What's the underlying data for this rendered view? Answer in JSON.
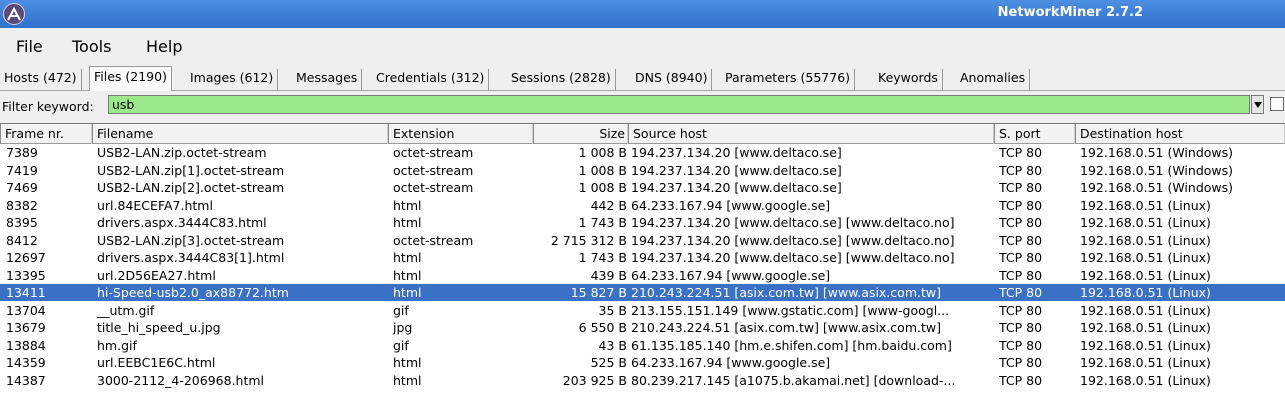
{
  "window": {
    "title": "NetworkMiner 2.7.2",
    "icon": "networkminer-app-icon"
  },
  "menu": [
    "File",
    "Tools",
    "Help"
  ],
  "tabs": [
    {
      "label": "Hosts (472)",
      "active": false
    },
    {
      "label": "Files (2190)",
      "active": true
    },
    {
      "label": "Images (612)",
      "active": false
    },
    {
      "label": "Messages",
      "active": false
    },
    {
      "label": "Credentials (312)",
      "active": false
    },
    {
      "label": "Sessions (2828)",
      "active": false
    },
    {
      "label": "DNS (8940)",
      "active": false
    },
    {
      "label": "Parameters (55776)",
      "active": false
    },
    {
      "label": "Keywords",
      "active": false
    },
    {
      "label": "Anomalies",
      "active": false
    }
  ],
  "filter": {
    "label": "Filter keyword:",
    "value": "usb",
    "dropdown_icon": "dropdown-arrow-icon",
    "input_color": "#9be98b"
  },
  "table": {
    "columns": [
      "Frame nr.",
      "Filename",
      "Extension",
      "Size",
      "Source host",
      "S. port",
      "Destination host"
    ],
    "selected_row_color": "#3a70c6",
    "rows": [
      {
        "frame": "7389",
        "filename": "USB2-LAN.zip.octet-stream",
        "extension": "octet-stream",
        "size": "1 008 B",
        "source": "194.237.134.20 [www.deltaco.se]",
        "sport": "TCP 80",
        "dest": "192.168.0.51 (Windows)",
        "selected": false
      },
      {
        "frame": "7419",
        "filename": "USB2-LAN.zip[1].octet-stream",
        "extension": "octet-stream",
        "size": "1 008 B",
        "source": "194.237.134.20 [www.deltaco.se]",
        "sport": "TCP 80",
        "dest": "192.168.0.51 (Windows)",
        "selected": false
      },
      {
        "frame": "7469",
        "filename": "USB2-LAN.zip[2].octet-stream",
        "extension": "octet-stream",
        "size": "1 008 B",
        "source": "194.237.134.20 [www.deltaco.se]",
        "sport": "TCP 80",
        "dest": "192.168.0.51 (Windows)",
        "selected": false
      },
      {
        "frame": "8382",
        "filename": "url.84ECEFA7.html",
        "extension": "html",
        "size": "442 B",
        "source": "64.233.167.94 [www.google.se]",
        "sport": "TCP 80",
        "dest": "192.168.0.51 (Linux)",
        "selected": false
      },
      {
        "frame": "8395",
        "filename": "drivers.aspx.3444C83.html",
        "extension": "html",
        "size": "1 743 B",
        "source": "194.237.134.20 [www.deltaco.se] [www.deltaco.no]",
        "sport": "TCP 80",
        "dest": "192.168.0.51 (Linux)",
        "selected": false
      },
      {
        "frame": "8412",
        "filename": "USB2-LAN.zip[3].octet-stream",
        "extension": "octet-stream",
        "size": "2 715 312 B",
        "source": "194.237.134.20 [www.deltaco.se] [www.deltaco.no]",
        "sport": "TCP 80",
        "dest": "192.168.0.51 (Linux)",
        "selected": false
      },
      {
        "frame": "12697",
        "filename": "drivers.aspx.3444C83[1].html",
        "extension": "html",
        "size": "1 743 B",
        "source": "194.237.134.20 [www.deltaco.se] [www.deltaco.no]",
        "sport": "TCP 80",
        "dest": "192.168.0.51 (Linux)",
        "selected": false
      },
      {
        "frame": "13395",
        "filename": "url.2D56EA27.html",
        "extension": "html",
        "size": "439 B",
        "source": "64.233.167.94 [www.google.se]",
        "sport": "TCP 80",
        "dest": "192.168.0.51 (Linux)",
        "selected": false
      },
      {
        "frame": "13411",
        "filename": "hi-Speed-usb2.0_ax88772.htm",
        "extension": "html",
        "size": "15 827 B",
        "source": "210.243.224.51 [asix.com.tw] [www.asix.com.tw]",
        "sport": "TCP 80",
        "dest": "192.168.0.51 (Linux)",
        "selected": true
      },
      {
        "frame": "13704",
        "filename": "__utm.gif",
        "extension": "gif",
        "size": "35 B",
        "source": "213.155.151.149 [www.gstatic.com] [www-googl...",
        "sport": "TCP 80",
        "dest": "192.168.0.51 (Linux)",
        "selected": false
      },
      {
        "frame": "13679",
        "filename": "title_hi_speed_u.jpg",
        "extension": "jpg",
        "size": "6 550 B",
        "source": "210.243.224.51 [asix.com.tw] [www.asix.com.tw]",
        "sport": "TCP 80",
        "dest": "192.168.0.51 (Linux)",
        "selected": false
      },
      {
        "frame": "13884",
        "filename": "hm.gif",
        "extension": "gif",
        "size": "43 B",
        "source": "61.135.185.140 [hm.e.shifen.com] [hm.baidu.com]",
        "sport": "TCP 80",
        "dest": "192.168.0.51 (Linux)",
        "selected": false
      },
      {
        "frame": "14359",
        "filename": "url.EEBC1E6C.html",
        "extension": "html",
        "size": "525 B",
        "source": "64.233.167.94 [www.google.se]",
        "sport": "TCP 80",
        "dest": "192.168.0.51 (Linux)",
        "selected": false
      },
      {
        "frame": "14387",
        "filename": "3000-2112_4-206968.html",
        "extension": "html",
        "size": "203 925 B",
        "source": "80.239.217.145 [a1075.b.akamai.net] [download-...",
        "sport": "TCP 80",
        "dest": "192.168.0.51 (Linux)",
        "selected": false
      }
    ]
  }
}
